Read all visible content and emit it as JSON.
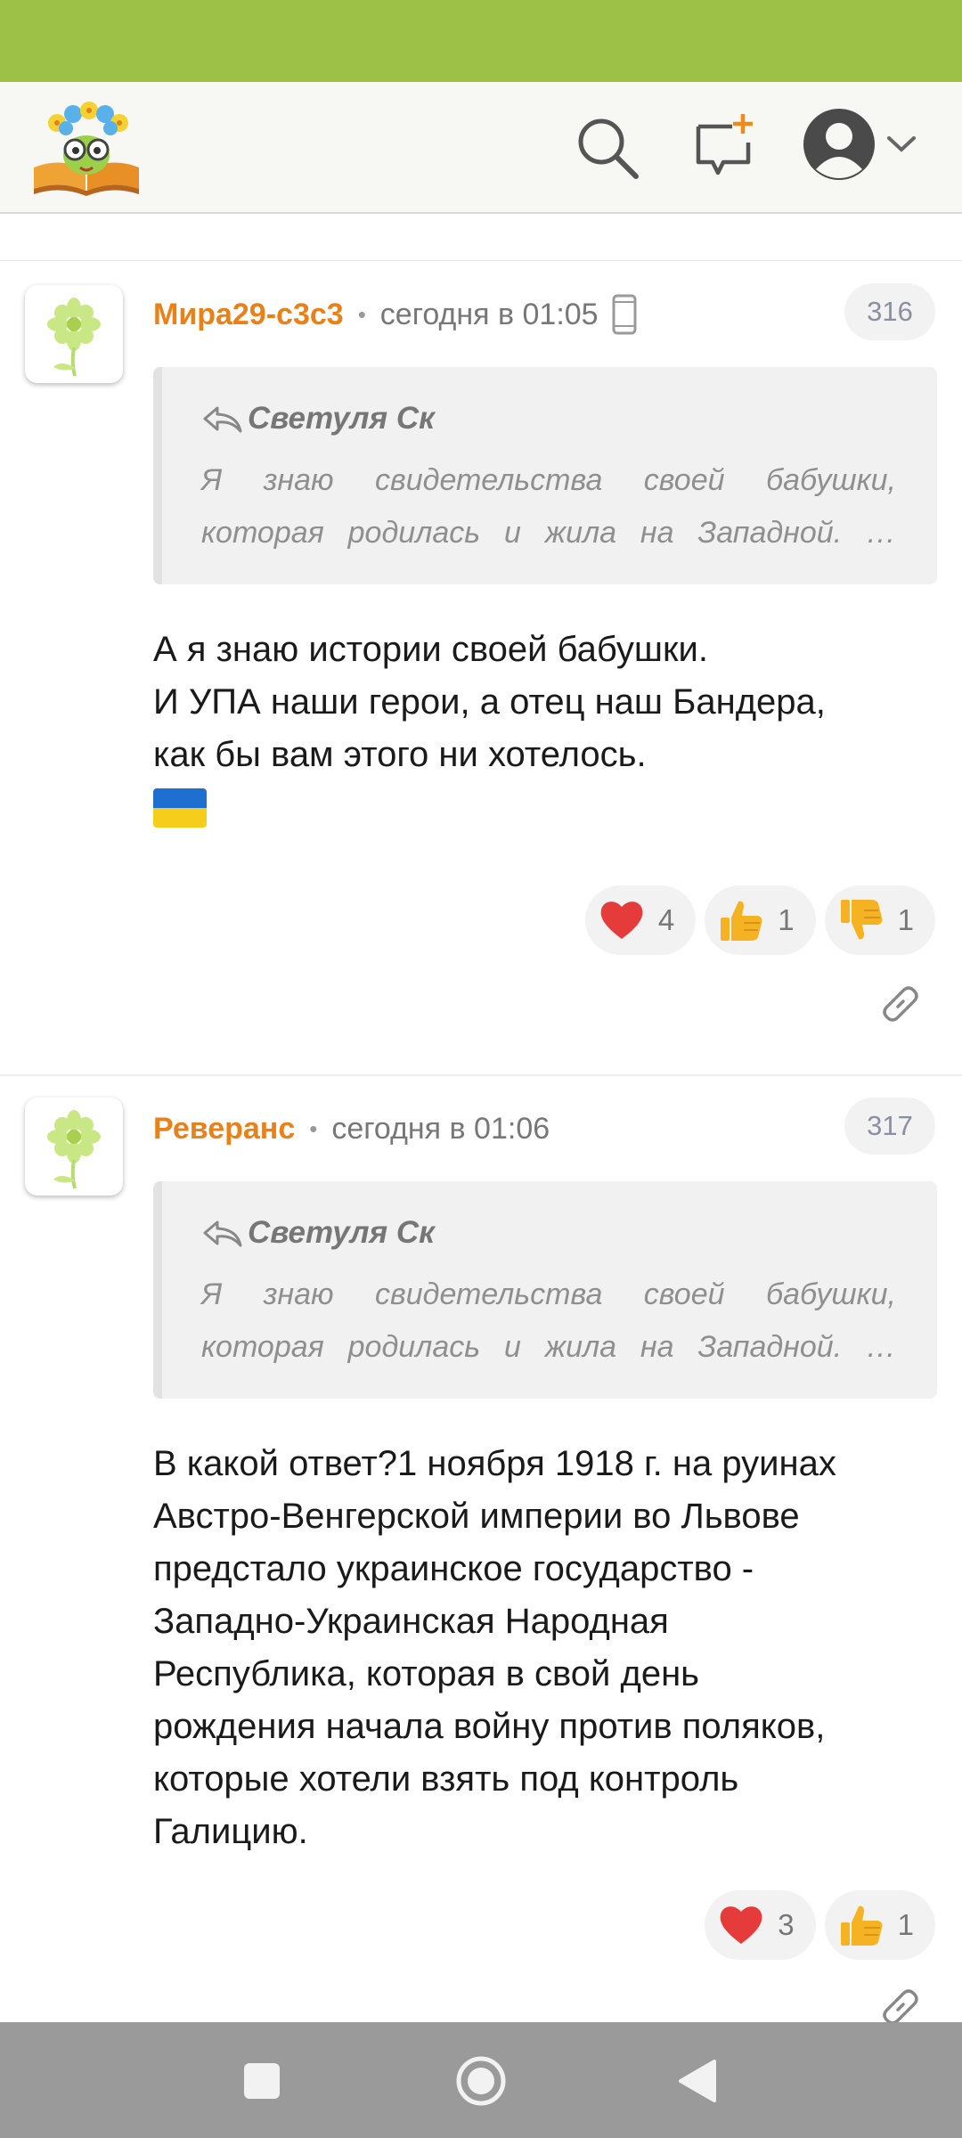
{
  "app": {
    "logo_name": "book-with-flowers-logo",
    "colors": {
      "status_bar": "#9dc146",
      "author": "#e8811a",
      "nav_bar": "#9a9a9a"
    },
    "header_icons": [
      "search-icon",
      "new-post-icon",
      "profile-avatar-icon",
      "chevron-down-icon"
    ]
  },
  "comments": [
    {
      "author": "Мира29-с3с3",
      "separator": "•",
      "time": "сегодня в 01:05",
      "device_icon": "mobile-phone-icon",
      "number": "316",
      "quote": {
        "author": "Светуля Ск",
        "line1": "Я знаю свидетельства своей бабушки,",
        "line2": "которая родилась и жила на Западной. …"
      },
      "lines": [
        "А я знаю истории своей бабушки.",
        "И УПА наши герои, а отец наш Бандера,",
        "как бы вам этого ни хотелось."
      ],
      "emoji_icon": "ukraine-flag-icon",
      "reactions": [
        {
          "icon": "heart-icon",
          "count": "4"
        },
        {
          "icon": "thumbs-up-icon",
          "count": "1"
        },
        {
          "icon": "thumbs-down-icon",
          "count": "1"
        }
      ]
    },
    {
      "author": "Реверанс",
      "separator": "•",
      "time": "сегодня в 01:06",
      "number": "317",
      "quote": {
        "author": "Светуля Ск",
        "line1": "Я знаю свидетельства своей бабушки,",
        "line2": "которая родилась и жила на Западной. …"
      },
      "lines": [
        "В какой ответ?1 ноября 1918 г. на руинах",
        "Австро-Венгерской империи во Львове",
        "предстало украинское государство -",
        "Западно-Украинская Народная",
        "Республика, которая в свой день",
        "рождения начала войну против поляков,",
        "которые хотели взять под контроль",
        "Галицию."
      ],
      "reactions": [
        {
          "icon": "heart-icon",
          "count": "3"
        },
        {
          "icon": "thumbs-up-icon",
          "count": "1"
        }
      ]
    }
  ],
  "navigation": [
    "recent-apps-button",
    "home-button",
    "back-button"
  ]
}
